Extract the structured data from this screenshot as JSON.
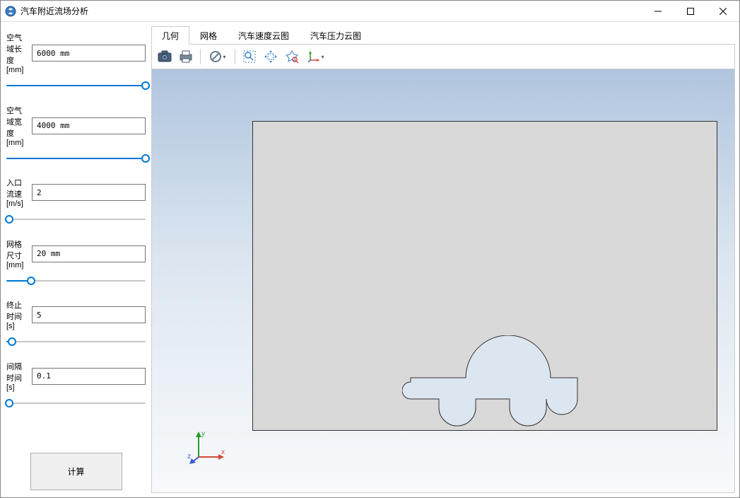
{
  "window": {
    "title": "汽车附近流场分析"
  },
  "sidebar": {
    "params": [
      {
        "label": "空气域长度[mm]",
        "value": "6000 mm",
        "slider_pct": 100
      },
      {
        "label": "空气域宽度[mm]",
        "value": "4000 mm",
        "slider_pct": 100
      },
      {
        "label": "入口流速[m/s]",
        "value": "2",
        "slider_pct": 2
      },
      {
        "label": "网格尺寸[mm]",
        "value": "20 mm",
        "slider_pct": 18
      },
      {
        "label": "终止时间[s]",
        "value": "5",
        "slider_pct": 4
      },
      {
        "label": "间隔时间[s]",
        "value": "0.1",
        "slider_pct": 2
      }
    ],
    "compute_button": "计算"
  },
  "tabs": [
    {
      "label": "几何",
      "active": true
    },
    {
      "label": "网格",
      "active": false
    },
    {
      "label": "汽车速度云图",
      "active": false
    },
    {
      "label": "汽车压力云图",
      "active": false
    }
  ],
  "toolbar_icons": [
    "camera-icon",
    "printer-icon",
    "sep",
    "block-icon",
    "sep",
    "zoom-box-icon",
    "pan-icon",
    "zoom-select-icon",
    "axis-icon"
  ],
  "axis": {
    "x": "x",
    "y": "y",
    "z": "z"
  }
}
